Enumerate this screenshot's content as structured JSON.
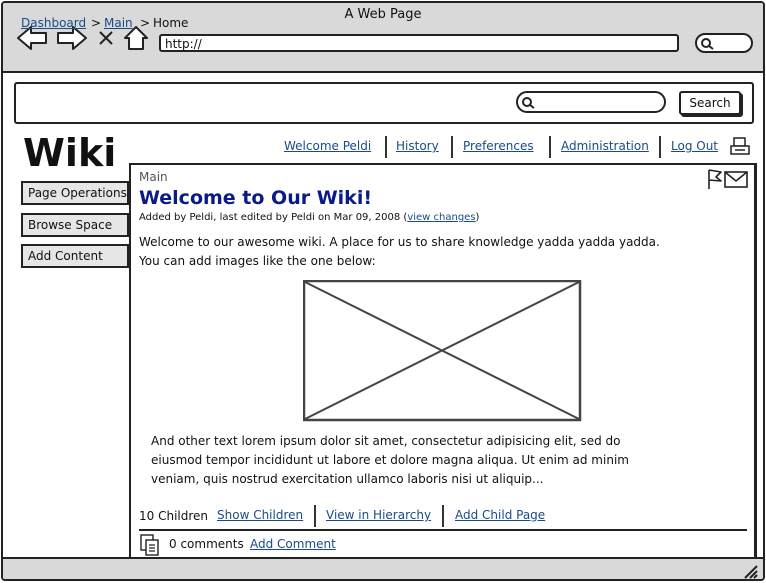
{
  "window": {
    "title": "A Web Page",
    "url": "http://"
  },
  "breadcrumb": {
    "items": [
      "Dashboard",
      "Main",
      "Home"
    ],
    "separator": ">"
  },
  "search": {
    "placeholder": "",
    "button_label": "Search"
  },
  "app": {
    "title": "Wiki"
  },
  "toplinks": [
    "Welcome Peldi",
    "History",
    "Preferences",
    "Administration",
    "Log Out"
  ],
  "sidebar": {
    "buttons": [
      "Page Operations",
      "Browse Space",
      "Add Content"
    ]
  },
  "page": {
    "space": "Main",
    "title": "Welcome to Our Wiki!",
    "meta_prefix": "Added by Peldi, last edited by Peldi on Mar 09, 2008 (",
    "meta_link": "view changes",
    "meta_suffix": ")",
    "intro_line1": "Welcome to our awesome wiki. A place for us to share knowledge yadda yadda yadda.",
    "intro_line2": "You can add images like the one below:",
    "body_line1": "And other text lorem ipsum dolor sit amet, consectetur adipisicing elit, sed do",
    "body_line2": "eiusmod tempor incididunt ut labore et dolore magna aliqua. Ut enim ad minim",
    "body_line3": "veniam, quis nostrud exercitation ullamco laboris nisi ut aliquip..."
  },
  "children": {
    "count_label": "10 Children",
    "links": [
      "Show Children",
      "View in Hierarchy",
      "Add Child Page"
    ]
  },
  "comments": {
    "count_label": "0 comments",
    "add_label": "Add Comment"
  },
  "colors": {
    "link": "#1a4a8a",
    "title": "#0a1a8a",
    "chrome": "#d9d9d9"
  }
}
